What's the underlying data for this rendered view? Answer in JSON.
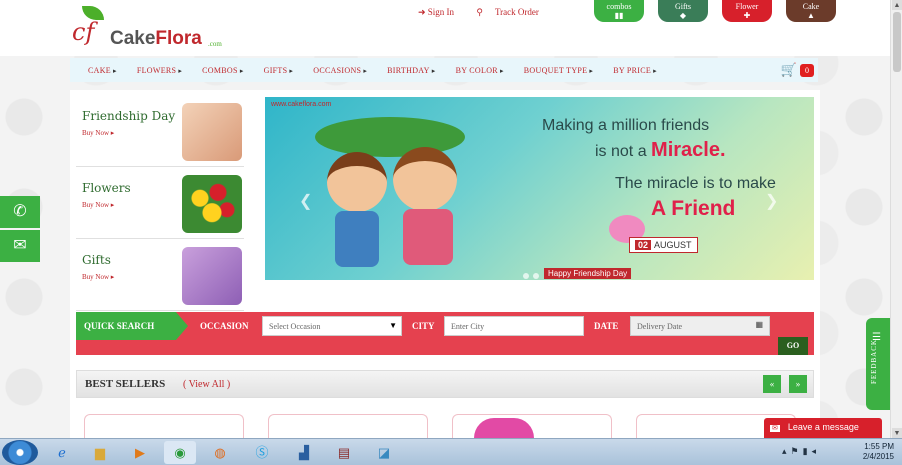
{
  "header": {
    "logo_mark": "cf",
    "logo_name_a": "Cake",
    "logo_name_b": "Flora",
    "logo_com": ".com",
    "signin": "Sign In",
    "track": "Track Order",
    "tabs": [
      {
        "label": "combos",
        "icon": "▮▮",
        "color": "#3cb043"
      },
      {
        "label": "Gifts",
        "icon": "◆",
        "color": "#3a7d58"
      },
      {
        "label": "Flower",
        "icon": "✚",
        "color": "#d7202b"
      },
      {
        "label": "Cake",
        "icon": "▲",
        "color": "#6b3b2a"
      }
    ]
  },
  "nav": {
    "items": [
      "CAKE",
      "FLOWERS",
      "COMBOS",
      "GIFTS",
      "OCCASIONS",
      "BIRTHDAY",
      "BY COLOR",
      "BOUQUET TYPE",
      "BY PRICE"
    ],
    "cart_count": "0"
  },
  "side": [
    {
      "title": "Friendship Day",
      "link": "Buy Now ▸"
    },
    {
      "title": "Flowers",
      "link": "Buy Now ▸"
    },
    {
      "title": "Gifts",
      "link": "Buy Now ▸"
    }
  ],
  "banner": {
    "site": "www.cakeflora.com",
    "line1": "Making a million friends",
    "line2a": "is not a ",
    "line2b": "Miracle.",
    "line3": "The miracle is to make",
    "line4": "A Friend",
    "date_num": "02",
    "date_month": "AUGUST",
    "caption": "Happy Friendship Day"
  },
  "quick_search": {
    "label": "QUICK SEARCH",
    "occasion_label": "OCCASION",
    "occasion_value": "Select Occasion",
    "city_label": "CITY",
    "city_placeholder": "Enter City",
    "date_label": "DATE",
    "date_placeholder": "Delivery Date",
    "go": "GO"
  },
  "best_sellers": {
    "title": "BEST SELLERS",
    "view_all": "( View All )"
  },
  "feedback": "FEEDBACK",
  "chat": "Leave a message",
  "taskbar": {
    "time": "1:55 PM",
    "date": "2/4/2015"
  }
}
